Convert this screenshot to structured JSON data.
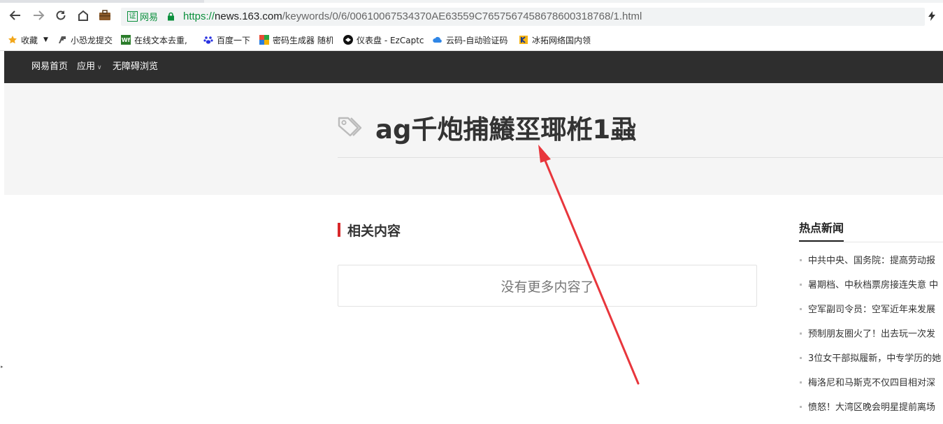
{
  "browser": {
    "cert_label": "网易",
    "cert_badge": "证",
    "url_scheme": "https://",
    "url_host": "news.163.com",
    "url_path": "/keywords/0/6/00610067534370AE63559C7657567458678600318768/1.html"
  },
  "bookmarks": [
    {
      "label": "收藏",
      "icon": "star-icon"
    },
    {
      "label": "小恐龙提交",
      "icon": "dino-icon"
    },
    {
      "label": "在线文本去重,",
      "icon": "wf-icon"
    },
    {
      "label": "百度一下",
      "icon": "baidu-paw-icon"
    },
    {
      "label": "密码生成器 随机",
      "icon": "puzzle-icon"
    },
    {
      "label": "仪表盘 - EzCaptc",
      "icon": "ezcaptcha-icon"
    },
    {
      "label": "云码-自动验证码",
      "icon": "cloud-icon"
    },
    {
      "label": "冰拓网络国内领",
      "icon": "bingtuo-icon"
    }
  ],
  "site_nav": {
    "home": "网易首页",
    "apps": "应用",
    "accessibility": "无障碍浏览"
  },
  "hero": {
    "title": "ag千炮捕鱶坙瑘栣1蝨"
  },
  "related": {
    "heading": "相关内容",
    "empty_message": "没有更多内容了"
  },
  "hot_news": {
    "heading": "热点新闻",
    "items": [
      "中共中央、国务院：提高劳动报",
      "暑期档、中秋档票房接连失意 中",
      "空军副司令员：空军近年来发展",
      "预制朋友圈火了！出去玩一次发",
      "3位女干部拟履新，中专学历的她",
      "梅洛尼和马斯克不仅四目相对深",
      "愤怒！大湾区晚会明星提前离场"
    ]
  },
  "colors": {
    "nav_bg": "#2e2e2e",
    "accent_red": "#d8282b",
    "annotation_arrow": "#e8363c",
    "secure_green": "#0a8f3c"
  }
}
